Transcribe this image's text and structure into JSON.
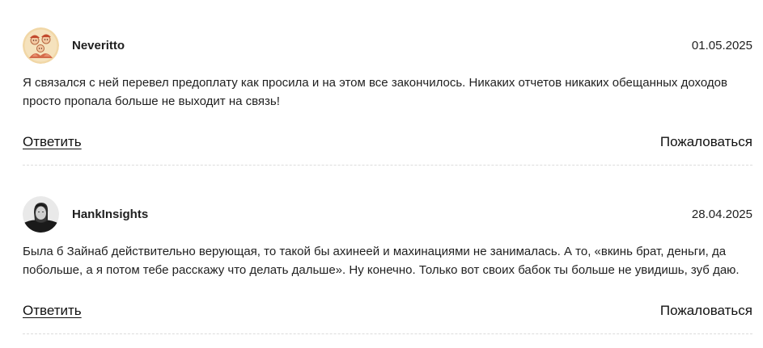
{
  "comments": [
    {
      "author": "Neveritto",
      "date": "01.05.2025",
      "avatar_icon": "cartoon-family-avatar-icon",
      "text": "Я связался с ней перевел предоплату как просила и на этом все закончилось. Никаких отчетов никаких обещанных доходов просто пропала больше не выходит на связь!",
      "reply_label": "Ответить",
      "report_label": "Пожаловаться"
    },
    {
      "author": "HankInsights",
      "date": "28.04.2025",
      "avatar_icon": "person-portrait-avatar-icon",
      "text": "Была б Зайнаб действительно верующая, то такой бы ахинеей и махинациями не занималась. А то, «вкинь брат, деньги, да побольше, а я потом тебе расскажу что делать дальше». Ну конечно. Только вот своих бабок ты больше не увидишь, зуб даю.",
      "reply_label": "Ответить",
      "report_label": "Пожаловаться"
    }
  ]
}
